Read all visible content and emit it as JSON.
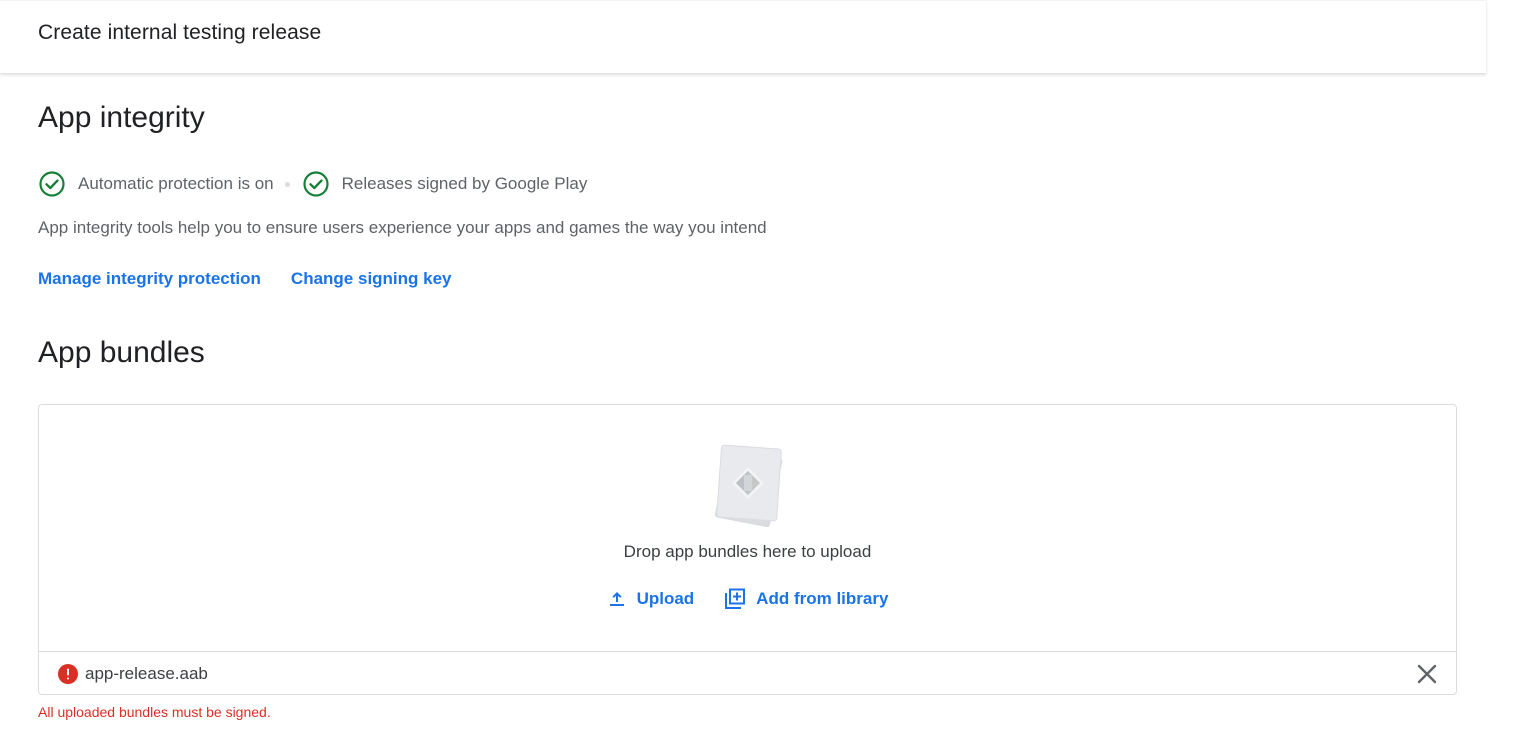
{
  "header": {
    "title": "Create internal testing release"
  },
  "app_integrity": {
    "heading": "App integrity",
    "statuses": [
      {
        "label": "Automatic protection is on",
        "icon": "check-circle-icon"
      },
      {
        "label": "Releases signed by Google Play",
        "icon": "check-circle-icon"
      }
    ],
    "description": "App integrity tools help you to ensure users experience your apps and games the way you intend",
    "links": {
      "manage": "Manage integrity protection",
      "change_key": "Change signing key"
    }
  },
  "app_bundles": {
    "heading": "App bundles",
    "drop_text": "Drop app bundles here to upload",
    "upload_label": "Upload",
    "library_label": "Add from library",
    "file": {
      "name": "app-release.aab",
      "status_icon": "error-icon"
    },
    "error_message": "All uploaded bundles must be signed."
  },
  "colors": {
    "accent": "#1a73e8",
    "success": "#188038",
    "error": "#d93025",
    "secondary_text": "#5f6368"
  }
}
